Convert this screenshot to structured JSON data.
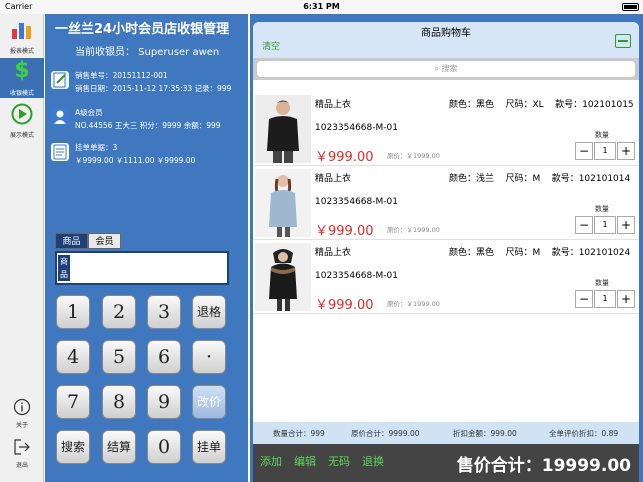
{
  "status": {
    "carrier": "Carrier",
    "time": "6:31 PM"
  },
  "sidebar": {
    "items": [
      {
        "label": "报表模式",
        "icon": "bar-chart-icon"
      },
      {
        "label": "收银模式",
        "icon": "dollar-icon"
      },
      {
        "label": "展示模式",
        "icon": "play-icon"
      }
    ],
    "bottom": [
      {
        "label": "关于",
        "icon": "info-icon"
      },
      {
        "label": "退出",
        "icon": "logout-icon"
      }
    ]
  },
  "header": {
    "title": "一丝兰24小时会员店收银管理",
    "cashier": "当前收银员： Superuser awen"
  },
  "sale": {
    "order_no": "销售单号：20151112-001",
    "date": "销售日期：2015-11-12 17:35:33 记录：999"
  },
  "member": {
    "level": "A级会员",
    "detail": "NO.44556 王大三 积分：9999 余额：999"
  },
  "hold": {
    "count": "挂单单据：3",
    "amounts": "￥9999.00 ￥1111.00 ￥9999.00"
  },
  "input": {
    "tabs": [
      "商品",
      "会员"
    ],
    "tag": "商品"
  },
  "keypad": {
    "keys": [
      "1",
      "2",
      "3",
      "退格",
      "4",
      "5",
      "6",
      "·",
      "7",
      "8",
      "9",
      "改价",
      "搜索",
      "结算",
      "0",
      "挂单"
    ]
  },
  "cart": {
    "title": "商品购物车",
    "clear": "清空",
    "search_placeholder": "搜索",
    "items": [
      {
        "name": "精品上衣",
        "color": "颜色：黑色",
        "size": "尺码：XL",
        "style_no": "款号：102101015",
        "code": "1023354668-M-01",
        "price": "￥999.00",
        "orig": "原价：￥1999.00",
        "qty_label": "数量",
        "qty": "1"
      },
      {
        "name": "精品上衣",
        "color": "颜色：浅兰",
        "size": "尺码：M",
        "style_no": "款号：102101014",
        "code": "1023354668-M-01",
        "price": "￥999.00",
        "orig": "原价：￥1999.00",
        "qty_label": "数量",
        "qty": "1"
      },
      {
        "name": "精品上衣",
        "color": "颜色：黑色",
        "size": "尺码：M",
        "style_no": "款号：102101024",
        "code": "1023354668-M-01",
        "price": "￥999.00",
        "orig": "原价：￥1999.00",
        "qty_label": "数量",
        "qty": "1"
      }
    ],
    "summary": {
      "qty_total": "数量合计：999",
      "orig_total": "原价合计：9999.00",
      "discount": "折扣金额：999.00",
      "order_discount": "全单评价折扣：0.89"
    },
    "actions": [
      "添加",
      "编辑",
      "无码",
      "退换"
    ],
    "total": "售价合计：19999.00"
  },
  "colors": {
    "primary": "#3f78bf",
    "accent_green": "#2e9d2e",
    "price_red": "#e22a2a"
  }
}
